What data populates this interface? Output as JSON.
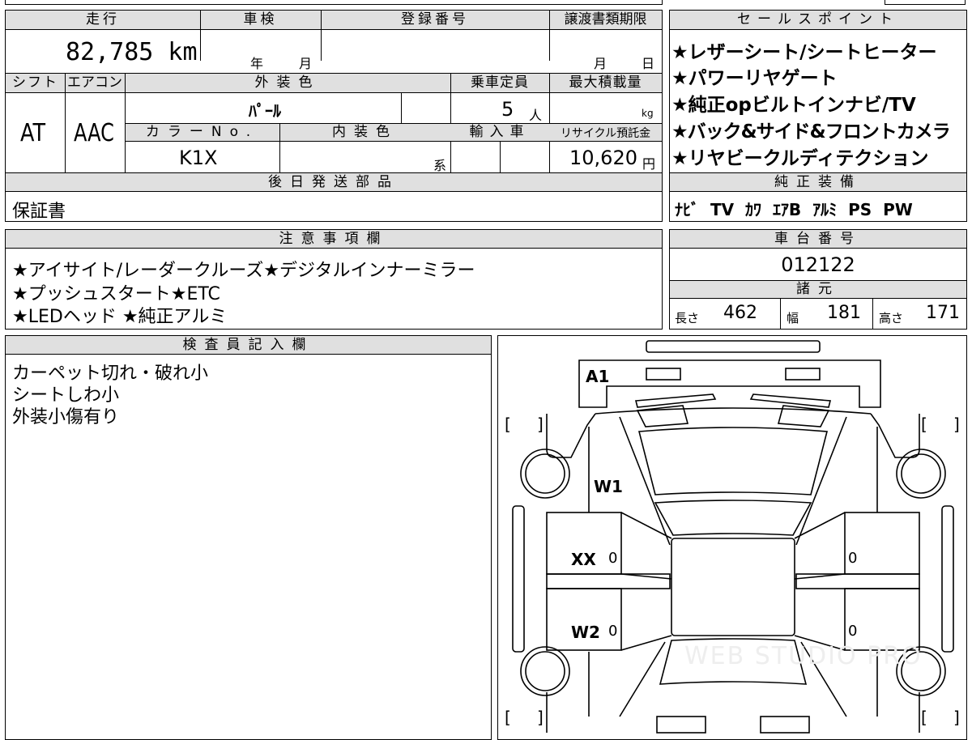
{
  "vehicle": {
    "mileage_label": "走行",
    "mileage": "82,785 km",
    "inspection_label": "車検",
    "inspection_year": "年",
    "inspection_month": "月",
    "registration_label": "登録番号",
    "transfer_label": "譲渡書類期限",
    "transfer_month": "月",
    "transfer_day": "日",
    "shift_label": "シフト",
    "shift": "AT",
    "aircon_label": "エアコン",
    "aircon": "AAC",
    "exterior_color_label": "外装色",
    "exterior_color": "ﾊﾟｰﾙ",
    "capacity_label": "乗車定員",
    "capacity": "5",
    "capacity_unit": "人",
    "max_load_label": "最大積載量",
    "max_load_unit": "kg",
    "color_no_label": "カラーNo.",
    "color_no": "K1X",
    "interior_color_label": "内装色",
    "interior_suffix": "系",
    "import_label": "輸入車",
    "recycle_label": "リサイクル預託金",
    "recycle_fee": "10,620",
    "recycle_unit": "円",
    "later_parts_label": "後日発送部品",
    "later_parts": "保証書"
  },
  "sales_points": {
    "title": "セールスポイント",
    "items": [
      "★レザーシート/シートヒーター",
      "★パワーリヤゲート",
      "★純正opビルトインナビ/TV",
      "★バック&サイド&フロントカメラ",
      "★リヤビークルディテクション"
    ]
  },
  "equipment": {
    "title": "純正装備",
    "items": [
      "ﾅﾋﾞ",
      "TV",
      "ｶﾜ",
      "ｴｱB",
      "ｱﾙﾐ",
      "PS",
      "PW"
    ]
  },
  "notes": {
    "title": "注意事項欄",
    "lines": [
      "★アイサイト/レーダークルーズ★デジタルインナーミラー",
      "★プッシュスタート★ETC",
      "★LEDヘッド ★純正アルミ"
    ]
  },
  "chassis": {
    "title": "車台番号",
    "number": "012122"
  },
  "specs": {
    "title": "諸元",
    "length_label": "長さ",
    "length": "462",
    "width_label": "幅",
    "width": "181",
    "height_label": "高さ",
    "height": "171"
  },
  "inspector": {
    "title": "検査員記入欄",
    "lines": [
      "カーペット切れ・破れ小",
      "シートしわ小",
      "外装小傷有り"
    ]
  },
  "diagram": {
    "marks": {
      "a1": "A1",
      "w1": "W1",
      "xx": "XX",
      "w2": "W2",
      "zero1": "0",
      "zero2": "0",
      "zero3": "0",
      "zero4": "0"
    },
    "watermark": "WEB STUDIO PRO"
  }
}
